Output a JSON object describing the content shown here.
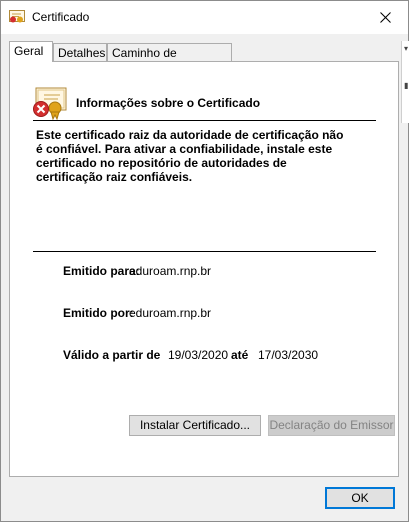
{
  "window": {
    "title": "Certificado"
  },
  "tabs": [
    {
      "label": "Geral",
      "active": true
    },
    {
      "label": "Detalhes",
      "active": false
    },
    {
      "label": "Caminho de Certificação",
      "active": false
    }
  ],
  "general": {
    "info_title": "Informações sobre o Certificado",
    "warning_lines": [
      "Este certificado raiz da autoridade de certificação não",
      "é confiável. Para ativar a confiabilidade, instale este",
      "certificado no repositório de autoridades de",
      "certificação raiz confiáveis."
    ],
    "issued_to_label": "Emitido para:",
    "issued_to_value": "eduroam.rnp.br",
    "issued_by_label": "Emitido por:",
    "issued_by_value": "eduroam.rnp.br",
    "valid_from_label": "Válido a partir de",
    "valid_from_value": "19/03/2020",
    "valid_to_label": "até",
    "valid_to_value": "17/03/2030"
  },
  "buttons": {
    "install": "Instalar Certificado...",
    "issuer_statement": "Declaração do Emissor",
    "ok": "OK"
  },
  "colors": {
    "accent": "#0078d7",
    "warning_red": "#d32f2f",
    "seal_gold": "#e0a31b"
  }
}
